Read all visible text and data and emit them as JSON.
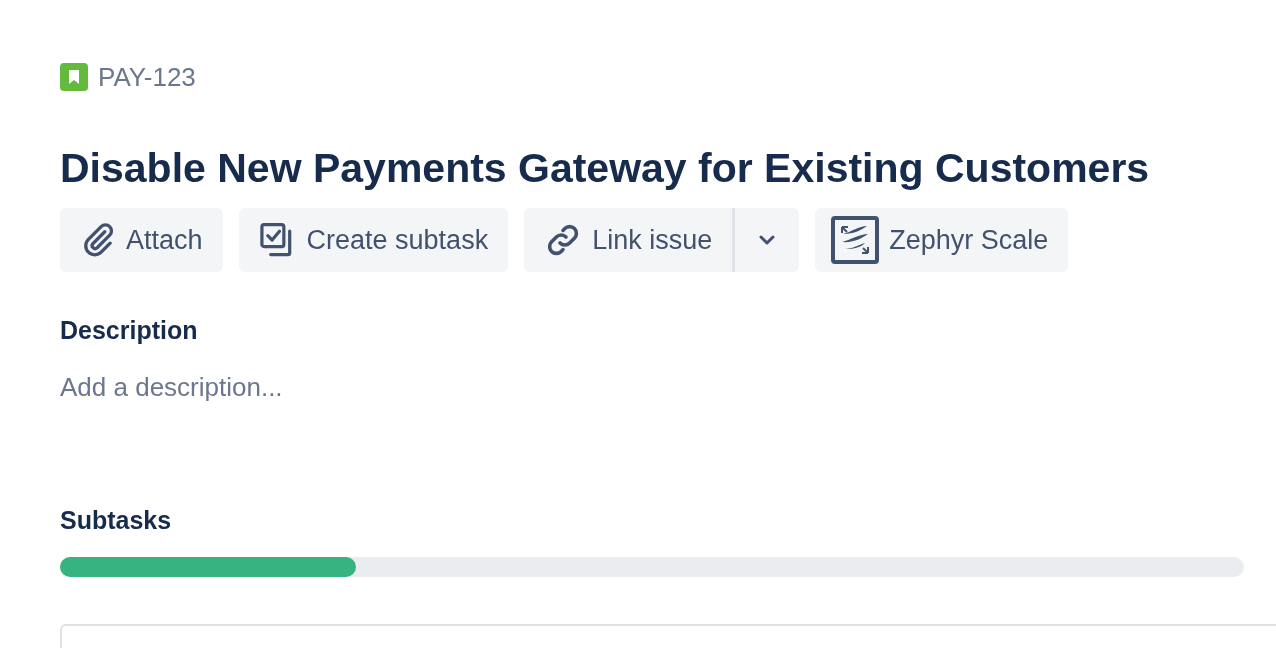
{
  "issue_key": "PAY-123",
  "title": "Disable New Payments Gateway for Existing Customers",
  "actions": [
    {
      "kind": "attach",
      "label": "Attach"
    },
    {
      "kind": "subtask",
      "label": "Create subtask"
    },
    {
      "kind": "link",
      "label": "Link issue"
    },
    {
      "kind": "zephyr",
      "label": "Zephyr Scale"
    }
  ],
  "description": {
    "heading": "Description",
    "placeholder": "Add a description..."
  },
  "subtasks": {
    "heading": "Subtasks",
    "progress": {
      "level": 0.25
    }
  }
}
